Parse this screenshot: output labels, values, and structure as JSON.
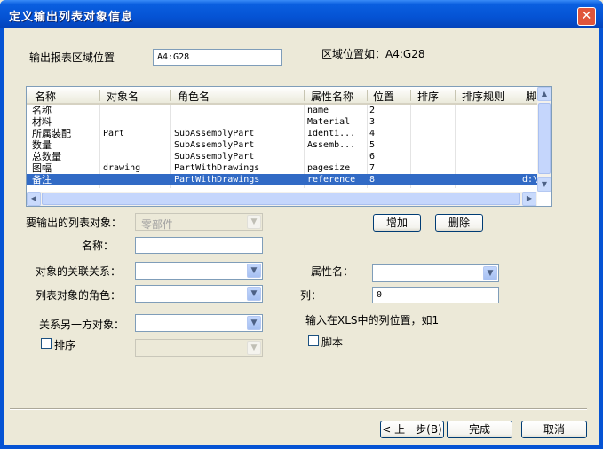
{
  "window": {
    "title": "定义输出列表对象信息",
    "close_label": "✕"
  },
  "region": {
    "label": "输出报表区域位置",
    "value": "A4:G28",
    "hint": "区域位置如：A4:G28"
  },
  "table": {
    "columns": [
      "名称",
      "对象名",
      "角色名",
      "属性名称",
      "位置",
      "排序",
      "排序规则",
      "脚"
    ],
    "rows": [
      {
        "name": "名称",
        "object": "",
        "role": "",
        "attr": "name",
        "pos": "2",
        "sort": "",
        "rule": "",
        "script": ""
      },
      {
        "name": "材料",
        "object": "",
        "role": "",
        "attr": "Material",
        "pos": "3",
        "sort": "",
        "rule": "",
        "script": ""
      },
      {
        "name": "所属装配",
        "object": "Part",
        "role": "SubAssemblyPart",
        "attr": "Identi...",
        "pos": "4",
        "sort": "",
        "rule": "",
        "script": ""
      },
      {
        "name": "数量",
        "object": "",
        "role": "SubAssemblyPart",
        "attr": "Assemb...",
        "pos": "5",
        "sort": "",
        "rule": "",
        "script": ""
      },
      {
        "name": "总数量",
        "object": "",
        "role": "SubAssemblyPart",
        "attr": "",
        "pos": "6",
        "sort": "",
        "rule": "",
        "script": ""
      },
      {
        "name": "图幅",
        "object": "drawing",
        "role": "PartWithDrawings",
        "attr": "pagesize",
        "pos": "7",
        "sort": "",
        "rule": "",
        "script": ""
      },
      {
        "name": "备注",
        "object": "",
        "role": "PartWithDrawings",
        "attr": "reference",
        "pos": "8",
        "sort": "",
        "rule": "",
        "script": "d:\\"
      }
    ],
    "selected_row": 6
  },
  "form": {
    "list_object_label": "要输出的列表对象：",
    "list_object_value": "零部件",
    "add_label": "增加",
    "delete_label": "删除",
    "name_label": "名称：",
    "name_value": "",
    "relation_label": "对象的关联关系：",
    "attr_label": "属性名：",
    "role_label": "列表对象的角色：",
    "col_label": "列：",
    "col_value": "0",
    "other_label": "关系另一方对象：",
    "col_hint": "输入在XLS中的列位置，如1",
    "sort_label": "排序",
    "script_label": "脚本"
  },
  "footer": {
    "prev_label": "< 上一步(B)",
    "finish_label": "完成",
    "cancel_label": "取消"
  }
}
